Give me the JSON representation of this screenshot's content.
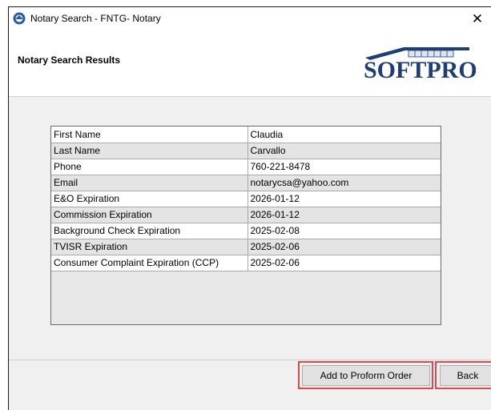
{
  "window": {
    "title": "Notary Search - FNTG- Notary",
    "close_glyph": "✕"
  },
  "header": {
    "title": "Notary Search Results",
    "logo_text": "SOFTPRO",
    "brand_color": "#1f3f74"
  },
  "results": {
    "rows": [
      {
        "label": "First Name",
        "value": "Claudia"
      },
      {
        "label": "Last Name",
        "value": "Carvallo"
      },
      {
        "label": "Phone",
        "value": "760-221-8478"
      },
      {
        "label": "Email",
        "value": "notarycsa@yahoo.com"
      },
      {
        "label": "E&O Expiration",
        "value": "2026-01-12"
      },
      {
        "label": "Commission Expiration",
        "value": "2026-01-12"
      },
      {
        "label": "Background Check Expiration",
        "value": "2025-02-08"
      },
      {
        "label": "TVISR Expiration",
        "value": "2025-02-06"
      },
      {
        "label": "Consumer Complaint Expiration (CCP)",
        "value": "2025-02-06"
      }
    ]
  },
  "footer": {
    "add_label": "Add to Proform Order",
    "back_label": "Back",
    "highlight_color": "#e0484d"
  }
}
